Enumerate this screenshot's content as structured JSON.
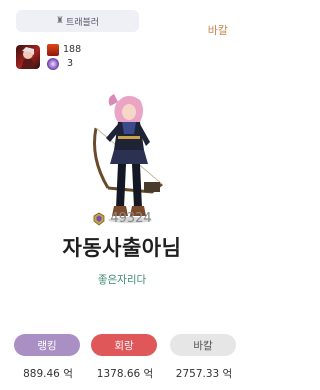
{
  "card": {
    "job_tag": {
      "icon": "traveler-icon",
      "label": "트래블러"
    },
    "server": "바칼",
    "stats": [
      {
        "icon": "red-crest-icon",
        "value": "188"
      },
      {
        "icon": "purple-orb-icon",
        "value": "3"
      }
    ],
    "fame": {
      "icon": "fame-emblem-icon",
      "value": "49324"
    },
    "nickname": "자동사출아님",
    "guild": "좋은자리다",
    "buttons": [
      {
        "label": "랭킹",
        "color": "#a98fc4"
      },
      {
        "label": "회랑",
        "color": "#e0575a"
      },
      {
        "label": "바칼",
        "color": "#e6e6e6"
      }
    ],
    "amounts": [
      "889.46 억",
      "1378.66 억",
      "2757.33 억"
    ]
  },
  "colors": {
    "server": "#c68a4e",
    "guild": "#3e8c74",
    "fame": "#8a8a8a"
  }
}
